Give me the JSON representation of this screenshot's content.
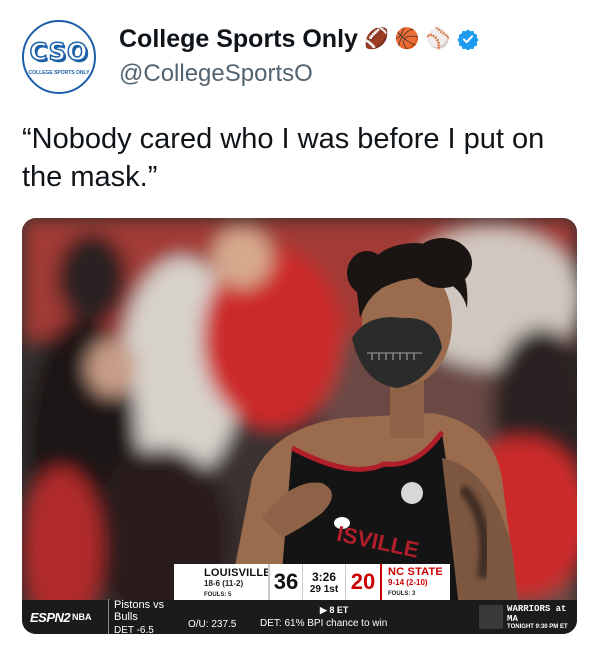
{
  "account": {
    "avatar_text": "CSO",
    "avatar_subtext": "COLLEGE SPORTS ONLY",
    "display_name": "College Sports Only",
    "badges": [
      "football-emoji",
      "basketball-emoji",
      "baseball-emoji"
    ],
    "badge_glyphs": [
      "🏈",
      "🏀",
      "⚾"
    ],
    "verified": true,
    "handle": "@CollegeSportsO"
  },
  "tweet": {
    "text": "“Nobody cared who I was before I put on the mask.”"
  },
  "media": {
    "jersey_text": "ISVILLE",
    "scoreboard": {
      "away": {
        "name": "LOUISVILLE",
        "record": "18-6 (11-2)",
        "fouls": "FOULS: 5",
        "score": "36"
      },
      "clock": "3:26",
      "period": "29  1st",
      "home": {
        "name": "NC STATE",
        "record": "9-14 (2-10)",
        "fouls": "FOULS: 3",
        "score": "20"
      }
    },
    "ticker": {
      "network": "ESPN2",
      "league": "NBA",
      "matchup": "Pistons vs Bulls",
      "spread": "DET -6.5",
      "total": "O/U: 237.5",
      "status": "▶ 8 ET",
      "bpi": "DET: 61% BPI chance to win",
      "promo_title": "WARRIORS at MA",
      "promo_sub": "TONIGHT 9:30 PM ET"
    }
  },
  "colors": {
    "accent_blue": "#1d9bf0",
    "nc_state_red": "#cc0000",
    "logo_blue": "#1c5fa8"
  }
}
